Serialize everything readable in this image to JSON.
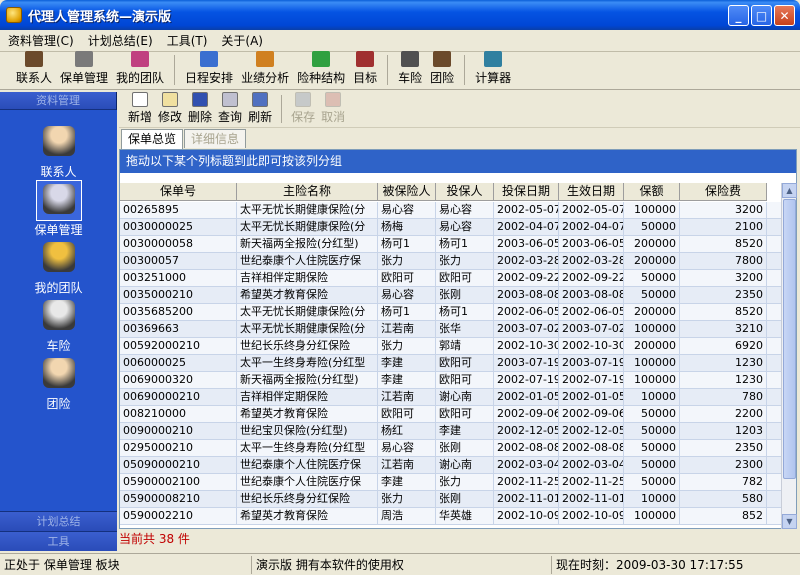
{
  "window": {
    "title": "代理人管理系统—演示版"
  },
  "menu": [
    "资料管理(C)",
    "计划总结(E)",
    "工具(T)",
    "关于(A)"
  ],
  "toolbar": [
    {
      "label": "联系人",
      "icon": "contacts-icon",
      "color": "#6b4a2b"
    },
    {
      "label": "保单管理",
      "icon": "policy-tools-icon",
      "color": "#7a7a7a"
    },
    {
      "label": "我的团队",
      "icon": "team-icon",
      "color": "#c04080"
    },
    {
      "label": "日程安排",
      "icon": "calendar-icon",
      "color": "#3a6fd0"
    },
    {
      "label": "业绩分析",
      "icon": "bar-chart-icon",
      "color": "#d08020"
    },
    {
      "label": "险种结构",
      "icon": "pie-chart-icon",
      "color": "#30a040"
    },
    {
      "label": "目标",
      "icon": "books-icon",
      "color": "#a03030"
    },
    {
      "label": "车险",
      "icon": "car-insurance-icon",
      "color": "#505050"
    },
    {
      "label": "团险",
      "icon": "group-insurance-icon",
      "color": "#6b4a2b"
    },
    {
      "label": "计算器",
      "icon": "calculator-icon",
      "color": "#3080a0"
    }
  ],
  "sidebar": {
    "header": "资料管理",
    "items": [
      {
        "label": "联系人",
        "icon": "contacts-icon"
      },
      {
        "label": "保单管理",
        "icon": "policy-icon"
      },
      {
        "label": "我的团队",
        "icon": "team-icon"
      },
      {
        "label": "车险",
        "icon": "car-insurance-icon"
      },
      {
        "label": "团险",
        "icon": "group-insurance-icon"
      }
    ],
    "footer1": "计划总结",
    "footer2": "工具"
  },
  "subtoolbar": [
    {
      "label": "新增",
      "icon": "new-icon",
      "enabled": true
    },
    {
      "label": "修改",
      "icon": "edit-icon",
      "enabled": true
    },
    {
      "label": "删除",
      "icon": "delete-icon",
      "enabled": true
    },
    {
      "label": "查询",
      "icon": "search-icon",
      "enabled": true
    },
    {
      "label": "刷新",
      "icon": "refresh-icon",
      "enabled": true
    },
    {
      "label": "保存",
      "icon": "save-icon",
      "enabled": false
    },
    {
      "label": "取消",
      "icon": "cancel-icon",
      "enabled": false
    }
  ],
  "tabs": [
    {
      "label": "保单总览",
      "active": true
    },
    {
      "label": "详细信息",
      "active": false
    }
  ],
  "grid": {
    "group_hint": "拖动以下某个列标题到此即可按该列分组",
    "columns": [
      "保单号",
      "主险名称",
      "被保险人",
      "投保人",
      "投保日期",
      "生效日期",
      "保额",
      "保险费"
    ],
    "rows": [
      [
        "00265895",
        "太平无忧长期健康保险(分",
        "易心容",
        "易心容",
        "2002-05-07",
        "2002-05-07",
        "100000",
        "3200"
      ],
      [
        "0030000025",
        "太平无忧长期健康保险(分",
        "杨梅",
        "易心容",
        "2002-04-07",
        "2002-04-07",
        "50000",
        "2100"
      ],
      [
        "0030000058",
        "新天福两全报险(分红型)",
        "杨可1",
        "杨可1",
        "2003-06-05",
        "2003-06-05",
        "200000",
        "8520"
      ],
      [
        "00300057",
        "世纪泰康个人住院医疗保",
        "张力",
        "张力",
        "2002-03-28",
        "2002-03-28",
        "200000",
        "7800"
      ],
      [
        "003251000",
        "吉祥相伴定期保险",
        "欧阳可",
        "欧阳可",
        "2002-09-22",
        "2002-09-22",
        "50000",
        "3200"
      ],
      [
        "0035000210",
        "希望英才教育保险",
        "易心容",
        "张刚",
        "2003-08-08",
        "2003-08-08",
        "50000",
        "2350"
      ],
      [
        "0035685200",
        "太平无忧长期健康保险(分",
        "杨可1",
        "杨可1",
        "2002-06-05",
        "2002-06-05",
        "200000",
        "8520"
      ],
      [
        "00369663",
        "太平无忧长期健康保险(分",
        "江若南",
        "张华",
        "2003-07-02",
        "2003-07-02",
        "100000",
        "3210"
      ],
      [
        "00592000210",
        "世纪长乐终身分红保险",
        "张力",
        "郭靖",
        "2002-10-30",
        "2002-10-30",
        "200000",
        "6920"
      ],
      [
        "006000025",
        "太平一生终身寿险(分红型",
        "李建",
        "欧阳可",
        "2003-07-19",
        "2003-07-19",
        "100000",
        "1230"
      ],
      [
        "0069000320",
        "新天福两全报险(分红型)",
        "李建",
        "欧阳可",
        "2002-07-19",
        "2002-07-19",
        "100000",
        "1230"
      ],
      [
        "00690000210",
        "吉祥相伴定期保险",
        "江若南",
        "谢心南",
        "2002-01-05",
        "2002-01-05",
        "10000",
        "780"
      ],
      [
        "008210000",
        "希望英才教育保险",
        "欧阳可",
        "欧阳可",
        "2002-09-06",
        "2002-09-06",
        "50000",
        "2200"
      ],
      [
        "0090000210",
        "世纪宝贝保险(分红型)",
        "杨红",
        "李建",
        "2002-12-05",
        "2002-12-05",
        "50000",
        "1203"
      ],
      [
        "0295000210",
        "太平一生终身寿险(分红型",
        "易心容",
        "张刚",
        "2002-08-08",
        "2002-08-08",
        "50000",
        "2350"
      ],
      [
        "05090000210",
        "世纪泰康个人住院医疗保",
        "江若南",
        "谢心南",
        "2002-03-04",
        "2002-03-04",
        "50000",
        "2300"
      ],
      [
        "05900002100",
        "世纪泰康个人住院医疗保",
        "李建",
        "张力",
        "2002-11-25",
        "2002-11-25",
        "50000",
        "782"
      ],
      [
        "05900008210",
        "世纪长乐终身分红保险",
        "张力",
        "张刚",
        "2002-11-01",
        "2002-11-01",
        "10000",
        "580"
      ],
      [
        "0590002210",
        "希望英才教育保险",
        "周浩",
        "华英雄",
        "2002-10-09",
        "2002-10-09",
        "100000",
        "852"
      ]
    ]
  },
  "record_count": "当前共 38 件",
  "status": {
    "location": "正处于 保单管理 板块",
    "license": "演示版 拥有本软件的使用权",
    "clock": "现在时刻：2009-03-30 17:17:55"
  }
}
